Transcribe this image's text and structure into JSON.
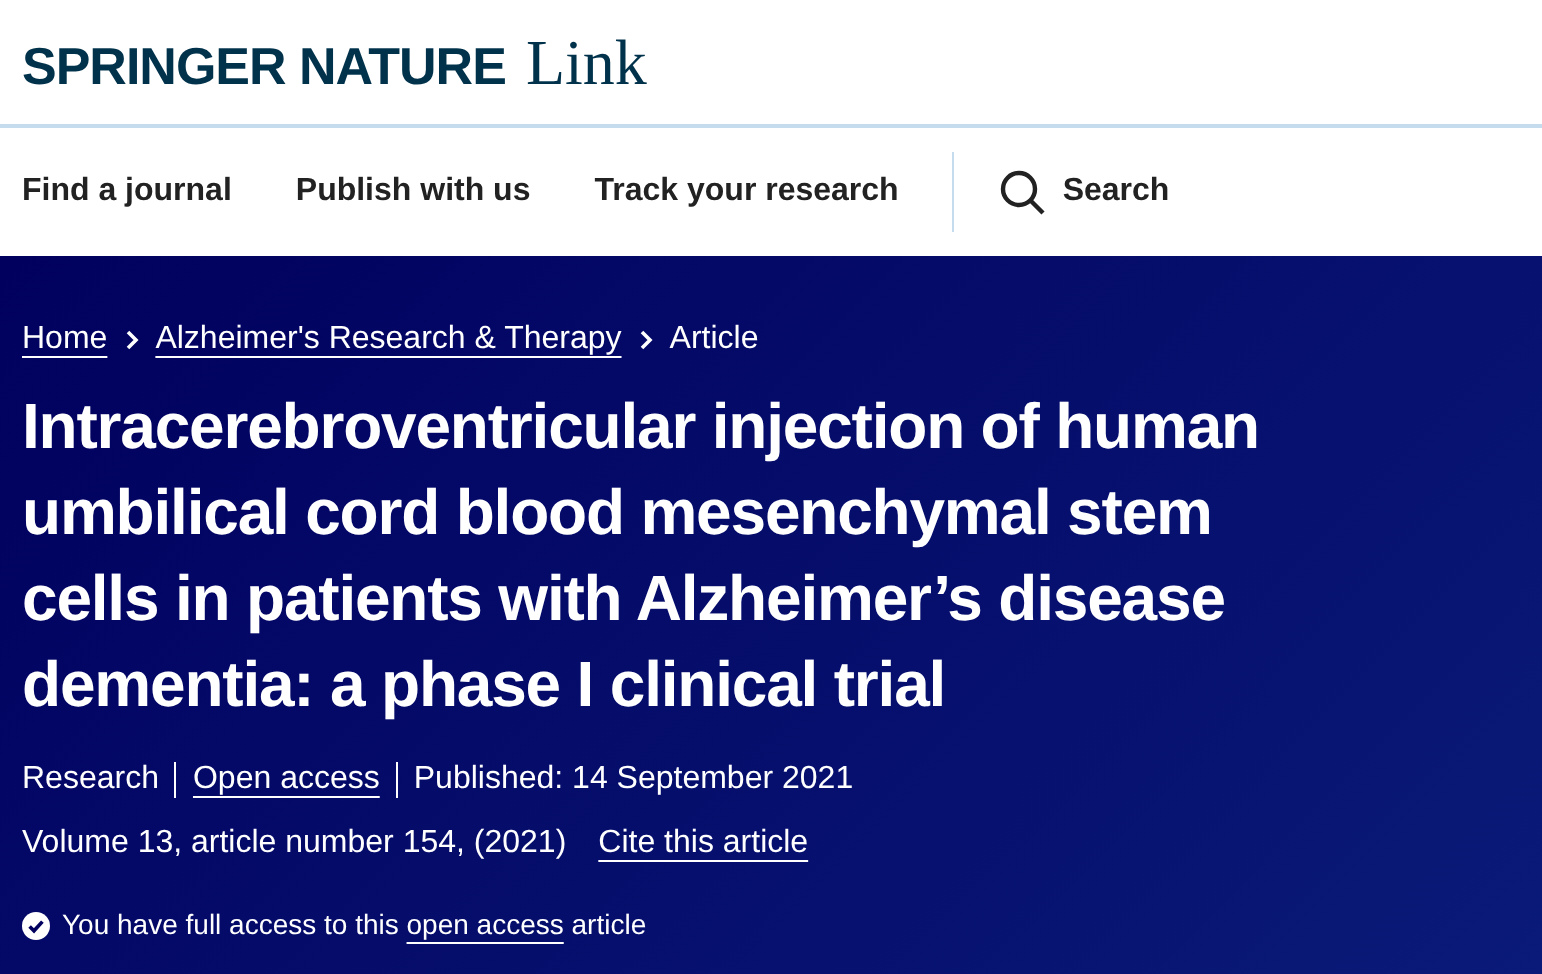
{
  "brand": {
    "name": "SPRINGER NATURE",
    "product": "Link"
  },
  "nav": {
    "items": [
      "Find a journal",
      "Publish with us",
      "Track your research"
    ],
    "search": "Search"
  },
  "breadcrumbs": [
    {
      "label": "Home",
      "kind": "link"
    },
    {
      "label": "Alzheimer's Research & Therapy",
      "kind": "link"
    },
    {
      "label": "Article",
      "kind": "text"
    }
  ],
  "title_lines": [
    "Intracerebroventricular injection of human",
    "umbilical cord blood mesenchymal stem",
    "cells in patients with Alzheimer’s disease",
    "dementia: a phase I clinical trial"
  ],
  "meta": [
    {
      "label": "Research",
      "kind": "text"
    },
    {
      "label": "Open access",
      "kind": "link"
    },
    {
      "label": "Published: 14 September 2021",
      "kind": "text"
    }
  ],
  "citation": {
    "text": "Volume 13, article number 154, (2021)",
    "link": "Cite this article"
  },
  "access": {
    "before": "You have full access to this",
    "link": "open access",
    "after": "article"
  }
}
